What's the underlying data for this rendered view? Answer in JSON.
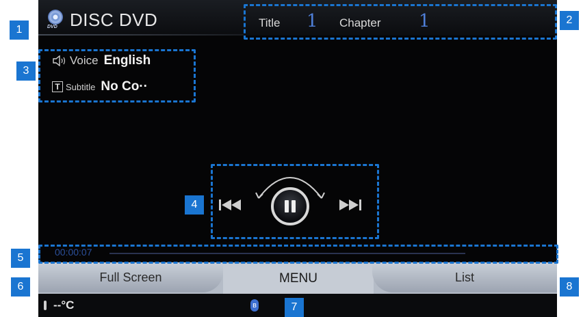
{
  "header": {
    "disc_label": "DVD",
    "app_title": "DISC DVD",
    "title_label": "Title",
    "title_value": "1",
    "chapter_label": "Chapter",
    "chapter_value": "1"
  },
  "info": {
    "voice_label": "Voice",
    "voice_value": "English",
    "subtitle_icon": "T",
    "subtitle_label": "Subtitle",
    "subtitle_value": "No Co··"
  },
  "controls": {
    "prev_icon": "previous-track-icon",
    "pause_icon": "pause-icon",
    "next_icon": "next-track-icon"
  },
  "progress": {
    "time": "00:00:07"
  },
  "bottom": {
    "full_screen": "Full Screen",
    "menu": "MENU",
    "list": "List"
  },
  "status": {
    "temperature": "--°C",
    "bluetooth_icon": "bluetooth-icon"
  },
  "callouts": [
    "1",
    "2",
    "3",
    "4",
    "5",
    "6",
    "7",
    "8"
  ],
  "colors": {
    "accent": "#1a75d1",
    "value_blue": "#4f7fd8",
    "screen_bg": "#050506"
  }
}
